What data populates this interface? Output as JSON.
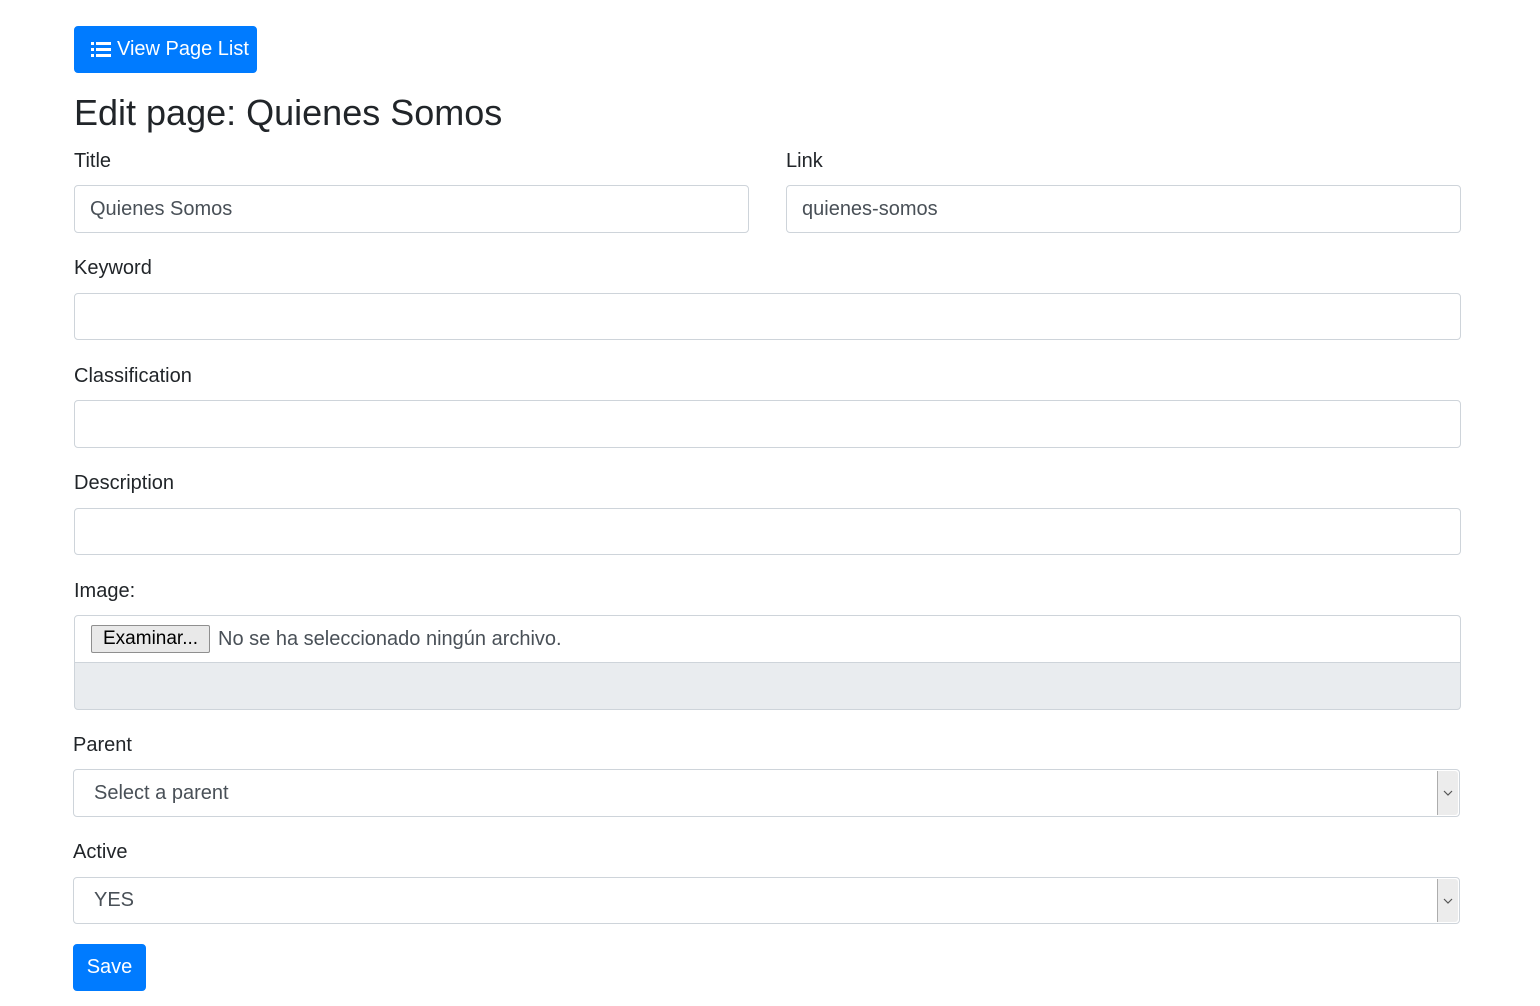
{
  "toolbar": {
    "view_list_label": "View Page List"
  },
  "page": {
    "title": "Edit page: Quienes Somos"
  },
  "form": {
    "title_label": "Title",
    "title_value": "Quienes Somos",
    "link_label": "Link",
    "link_value": "quienes-somos",
    "keyword_label": "Keyword",
    "keyword_value": "",
    "classification_label": "Classification",
    "classification_value": "",
    "description_label": "Description",
    "description_value": "",
    "image_label": "Image:",
    "file_button_label": "Examinar...",
    "file_status": "No se ha seleccionado ningún archivo.",
    "parent_label": "Parent",
    "parent_selected": "Select a parent",
    "active_label": "Active",
    "active_selected": "YES",
    "save_label": "Save"
  },
  "icons": {
    "view_list": "list-icon",
    "dropdown": "chevron-down-icon"
  },
  "colors": {
    "primary": "#007bff",
    "readonly_bg": "#e9ecef",
    "border": "#ced4da"
  }
}
